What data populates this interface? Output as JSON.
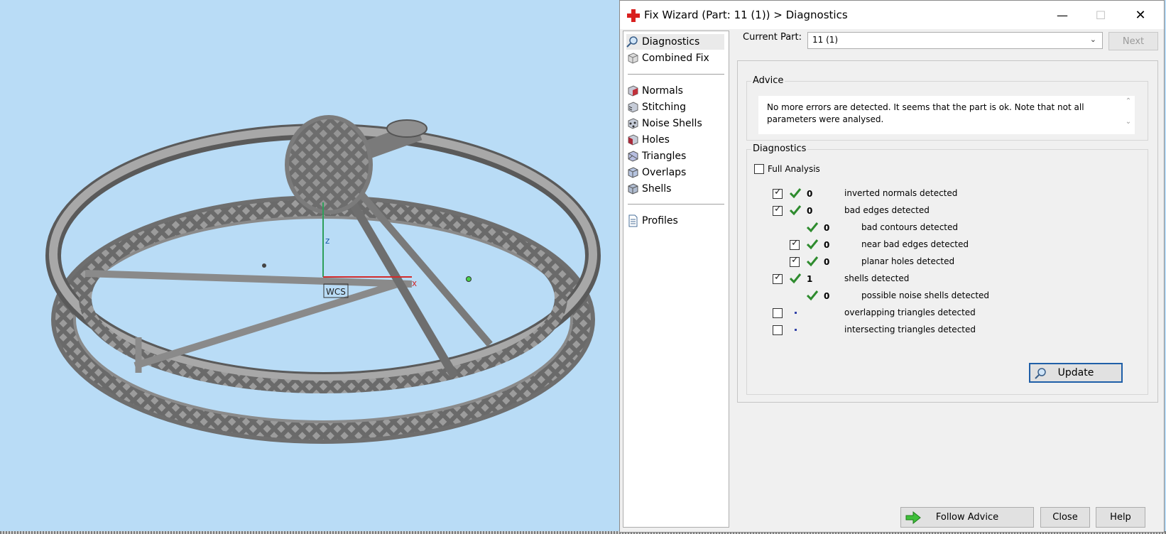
{
  "viewport": {
    "axis_z_label": "z",
    "axis_x_label": "x",
    "wcs_label": "WCS",
    "background": "#b9dcf6"
  },
  "dialog": {
    "title": "Fix Wizard (Part: 11 (1)) > Diagnostics",
    "title_icon": "red-cross-icon",
    "minimize": "—",
    "maximize": "☐",
    "close": "✕",
    "nav": {
      "top": [
        {
          "label": "Diagnostics",
          "icon": "magnifier-icon",
          "selected": true
        },
        {
          "label": "Combined Fix",
          "icon": "cube-icon"
        }
      ],
      "tools": [
        {
          "label": "Normals",
          "icon": "normals-cube-icon"
        },
        {
          "label": "Stitching",
          "icon": "stitching-cube-icon"
        },
        {
          "label": "Noise Shells",
          "icon": "noise-shells-icon"
        },
        {
          "label": "Holes",
          "icon": "holes-cube-icon"
        },
        {
          "label": "Triangles",
          "icon": "triangles-cube-icon"
        },
        {
          "label": "Overlaps",
          "icon": "overlaps-cube-icon"
        },
        {
          "label": "Shells",
          "icon": "shells-cube-icon"
        }
      ],
      "bottom": [
        {
          "label": "Profiles",
          "icon": "document-icon"
        }
      ]
    },
    "current_part_label": "Current Part:",
    "current_part_value": "11 (1)",
    "next_label": "Next",
    "advice": {
      "title": "Advice",
      "text": "No more errors are detected. It seems that the part is ok. Note that not all parameters were analysed."
    },
    "diagnostics": {
      "title": "Diagnostics",
      "full_analysis_label": "Full Analysis",
      "full_analysis_checked": false,
      "rows": [
        {
          "checkbox": true,
          "checked": true,
          "status": "ok",
          "count": "0",
          "label": "inverted normals detected",
          "indent": 0
        },
        {
          "checkbox": true,
          "checked": true,
          "status": "ok",
          "count": "0",
          "label": "bad edges detected",
          "indent": 0
        },
        {
          "checkbox": false,
          "checked": false,
          "status": "ok",
          "count": "0",
          "label": "bad contours detected",
          "indent": 1
        },
        {
          "checkbox": true,
          "checked": true,
          "status": "ok",
          "count": "0",
          "label": "near bad edges detected",
          "indent": 1
        },
        {
          "checkbox": true,
          "checked": true,
          "status": "ok",
          "count": "0",
          "label": "planar holes detected",
          "indent": 1
        },
        {
          "checkbox": true,
          "checked": true,
          "status": "ok",
          "count": "1",
          "label": "shells detected",
          "indent": 0
        },
        {
          "checkbox": false,
          "checked": false,
          "status": "ok",
          "count": "0",
          "label": "possible noise shells detected",
          "indent": 1
        },
        {
          "checkbox": true,
          "checked": false,
          "status": "unknown",
          "count": "",
          "label": "overlapping triangles detected",
          "indent": 0
        },
        {
          "checkbox": true,
          "checked": false,
          "status": "unknown",
          "count": "",
          "label": "intersecting triangles detected",
          "indent": 0
        }
      ]
    },
    "update_label": "Update",
    "follow_advice_label": "Follow Advice",
    "close_label": "Close",
    "help_label": "Help",
    "colors": {
      "ok_tick": "#2e8b2e",
      "accent_border": "#1f5fa8",
      "title_icon": "#d9201f"
    }
  }
}
